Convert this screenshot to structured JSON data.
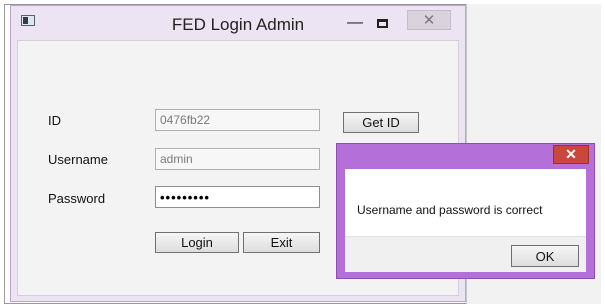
{
  "window": {
    "title": "FED Login Admin",
    "minimize_glyph": "—",
    "close_glyph": "✕"
  },
  "form": {
    "id_label": "ID",
    "id_value": "0476fb22",
    "get_id_label": "Get ID",
    "username_label": "Username",
    "username_value": "admin",
    "password_label": "Password",
    "password_mask": "•••••••••",
    "login_label": "Login",
    "exit_label": "Exit"
  },
  "message_box": {
    "close_glyph": "✕",
    "text": "Username and password is correct",
    "ok_label": "OK"
  },
  "colors": {
    "dialog_accent": "#b56fd8",
    "close_red": "#c9473f",
    "window_frame": "#ece3f3"
  }
}
